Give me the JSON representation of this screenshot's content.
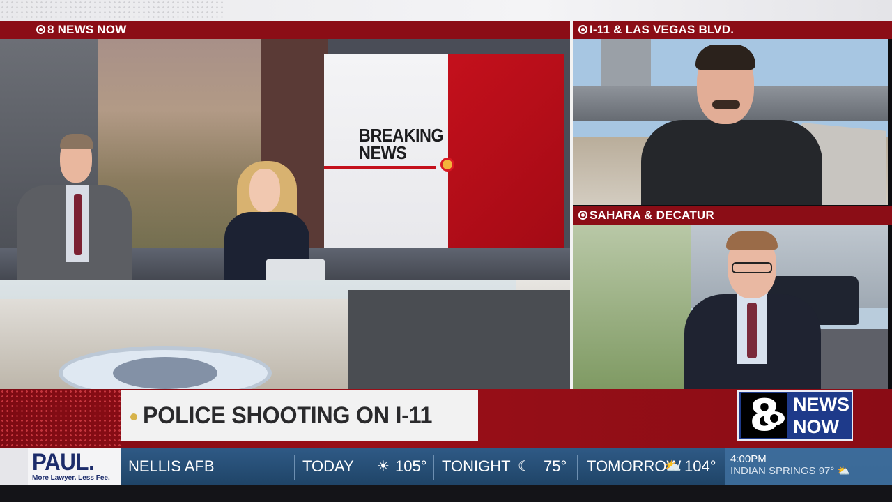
{
  "labels": {
    "main": "8 NEWS NOW",
    "feed_top": "I-11 & LAS VEGAS BLVD.",
    "feed_bottom": "SAHARA & DECATUR"
  },
  "studio_screen": {
    "line1": "BREAKING",
    "line2": "NEWS"
  },
  "headline": "POLICE SHOOTING ON I-11",
  "logo": {
    "digit": "8",
    "word1": "NEWS",
    "word2": "NOW"
  },
  "sponsor": {
    "name": "PAUL.",
    "tagline": "More Lawyer. Less Fee."
  },
  "ticker": {
    "location": "NELLIS AFB",
    "today_label": "TODAY",
    "today_icon": "sun-icon",
    "today_temp": "105°",
    "tonight_label": "TONIGHT",
    "tonight_icon": "moon-icon",
    "tonight_temp": "75°",
    "tomorrow_label": "TOMORROW",
    "tomorrow_icon": "partly-cloudy-icon",
    "tomorrow_temp": "104°",
    "time": "4:00PM",
    "next_location": "INDIAN SPRINGS",
    "next_temp": "97°"
  },
  "colors": {
    "label_bar": "#8b0d16",
    "lower_third": "#9a0f18",
    "ticker": "#2f5a86",
    "logo_box": "#1e3a8a"
  }
}
